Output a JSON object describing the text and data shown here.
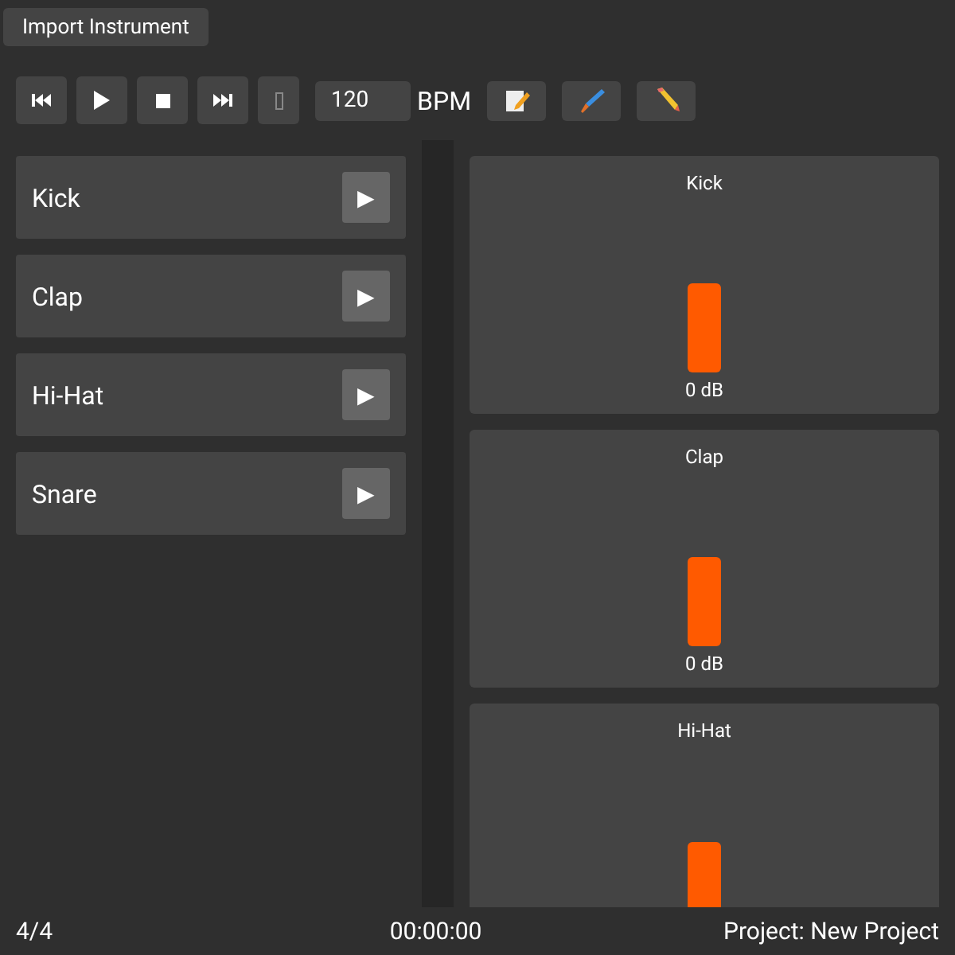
{
  "toolbar": {
    "import_button": "Import Instrument"
  },
  "transport": {
    "buttons": [
      {
        "kind": "rewind"
      },
      {
        "kind": "play"
      },
      {
        "kind": "stop"
      },
      {
        "kind": "forward"
      },
      {
        "kind": "unknown"
      }
    ],
    "bpm_value": "120",
    "bpm_label": "BPM",
    "tools": [
      {
        "kind": "notepad"
      },
      {
        "kind": "brush"
      },
      {
        "kind": "pencil"
      }
    ]
  },
  "instruments": [
    {
      "name": "Kick",
      "play": "▶"
    },
    {
      "name": "Clap",
      "play": "▶"
    },
    {
      "name": "Hi-Hat",
      "play": "▶"
    },
    {
      "name": "Snare",
      "play": "▶"
    }
  ],
  "mixer": [
    {
      "name": "Kick",
      "level": 0.5,
      "reading": "0 dB"
    },
    {
      "name": "Clap",
      "level": 0.5,
      "reading": "0 dB"
    },
    {
      "name": "Hi-Hat",
      "level": 0.5
    }
  ],
  "status_bar": {
    "time_signature": "4/4",
    "time": "00:00:00",
    "project": "Project: New Project"
  }
}
